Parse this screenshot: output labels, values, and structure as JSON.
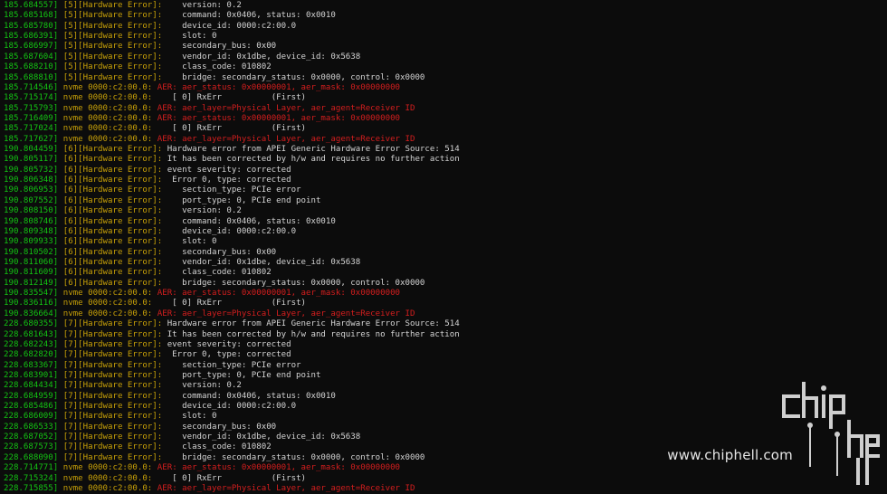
{
  "terminal": {
    "lines": [
      [
        "185.684557]",
        "[5][Hardware Error]:",
        "   version: 0.2",
        "n"
      ],
      [
        "185.685168]",
        "[5][Hardware Error]:",
        "   command: 0x0406, status: 0x0010",
        "n"
      ],
      [
        "185.685780]",
        "[5][Hardware Error]:",
        "   device_id: 0000:c2:00.0",
        "n"
      ],
      [
        "185.686391]",
        "[5][Hardware Error]:",
        "   slot: 0",
        "n"
      ],
      [
        "185.686997]",
        "[5][Hardware Error]:",
        "   secondary_bus: 0x00",
        "n"
      ],
      [
        "185.687604]",
        "[5][Hardware Error]:",
        "   vendor_id: 0x1dbe, device_id: 0x5638",
        "n"
      ],
      [
        "185.688210]",
        "[5][Hardware Error]:",
        "   class_code: 010802",
        "n"
      ],
      [
        "185.688810]",
        "[5][Hardware Error]:",
        "   bridge: secondary_status: 0x0000, control: 0x0000",
        "n"
      ],
      [
        "185.714546]",
        "nvme 0000:c2:00.0:",
        "AER: aer_status: 0x00000001, aer_mask: 0x00000000",
        "e"
      ],
      [
        "185.715174]",
        "nvme 0000:c2:00.0:",
        "   [ 0] RxErr          (First)",
        "n"
      ],
      [
        "185.715793]",
        "nvme 0000:c2:00.0:",
        "AER: aer_layer=Physical Layer, aer_agent=Receiver ID",
        "e"
      ],
      [
        "185.716409]",
        "nvme 0000:c2:00.0:",
        "AER: aer_status: 0x00000001, aer_mask: 0x00000000",
        "e"
      ],
      [
        "185.717024]",
        "nvme 0000:c2:00.0:",
        "   [ 0] RxErr          (First)",
        "n"
      ],
      [
        "185.717627]",
        "nvme 0000:c2:00.0:",
        "AER: aer_layer=Physical Layer, aer_agent=Receiver ID",
        "e"
      ],
      [
        "190.804459]",
        "[6][Hardware Error]:",
        "Hardware error from APEI Generic Hardware Error Source: 514",
        "n"
      ],
      [
        "190.805117]",
        "[6][Hardware Error]:",
        "It has been corrected by h/w and requires no further action",
        "n"
      ],
      [
        "190.805732]",
        "[6][Hardware Error]:",
        "event severity: corrected",
        "n"
      ],
      [
        "190.806348]",
        "[6][Hardware Error]:",
        " Error 0, type: corrected",
        "n"
      ],
      [
        "190.806953]",
        "[6][Hardware Error]:",
        "   section_type: PCIe error",
        "n"
      ],
      [
        "190.807552]",
        "[6][Hardware Error]:",
        "   port_type: 0, PCIe end point",
        "n"
      ],
      [
        "190.808150]",
        "[6][Hardware Error]:",
        "   version: 0.2",
        "n"
      ],
      [
        "190.808746]",
        "[6][Hardware Error]:",
        "   command: 0x0406, status: 0x0010",
        "n"
      ],
      [
        "190.809348]",
        "[6][Hardware Error]:",
        "   device_id: 0000:c2:00.0",
        "n"
      ],
      [
        "190.809933]",
        "[6][Hardware Error]:",
        "   slot: 0",
        "n"
      ],
      [
        "190.810502]",
        "[6][Hardware Error]:",
        "   secondary_bus: 0x00",
        "n"
      ],
      [
        "190.811060]",
        "[6][Hardware Error]:",
        "   vendor_id: 0x1dbe, device_id: 0x5638",
        "n"
      ],
      [
        "190.811609]",
        "[6][Hardware Error]:",
        "   class_code: 010802",
        "n"
      ],
      [
        "190.812149]",
        "[6][Hardware Error]:",
        "   bridge: secondary_status: 0x0000, control: 0x0000",
        "n"
      ],
      [
        "190.835547]",
        "nvme 0000:c2:00.0:",
        "AER: aer_status: 0x00000001, aer_mask: 0x00000000",
        "e"
      ],
      [
        "190.836116]",
        "nvme 0000:c2:00.0:",
        "   [ 0] RxErr          (First)",
        "n"
      ],
      [
        "190.836664]",
        "nvme 0000:c2:00.0:",
        "AER: aer_layer=Physical Layer, aer_agent=Receiver ID",
        "e"
      ],
      [
        "228.680355]",
        "[7][Hardware Error]:",
        "Hardware error from APEI Generic Hardware Error Source: 514",
        "n"
      ],
      [
        "228.681643]",
        "[7][Hardware Error]:",
        "It has been corrected by h/w and requires no further action",
        "n"
      ],
      [
        "228.682243]",
        "[7][Hardware Error]:",
        "event severity: corrected",
        "n"
      ],
      [
        "228.682820]",
        "[7][Hardware Error]:",
        " Error 0, type: corrected",
        "n"
      ],
      [
        "228.683367]",
        "[7][Hardware Error]:",
        "   section_type: PCIe error",
        "n"
      ],
      [
        "228.683901]",
        "[7][Hardware Error]:",
        "   port_type: 0, PCIe end point",
        "n"
      ],
      [
        "228.684434]",
        "[7][Hardware Error]:",
        "   version: 0.2",
        "n"
      ],
      [
        "228.684959]",
        "[7][Hardware Error]:",
        "   command: 0x0406, status: 0x0010",
        "n"
      ],
      [
        "228.685486]",
        "[7][Hardware Error]:",
        "   device_id: 0000:c2:00.0",
        "n"
      ],
      [
        "228.686009]",
        "[7][Hardware Error]:",
        "   slot: 0",
        "n"
      ],
      [
        "228.686533]",
        "[7][Hardware Error]:",
        "   secondary_bus: 0x00",
        "n"
      ],
      [
        "228.687052]",
        "[7][Hardware Error]:",
        "   vendor_id: 0x1dbe, device_id: 0x5638",
        "n"
      ],
      [
        "228.687573]",
        "[7][Hardware Error]:",
        "   class_code: 010802",
        "n"
      ],
      [
        "228.688090]",
        "[7][Hardware Error]:",
        "   bridge: secondary_status: 0x0000, control: 0x0000",
        "n"
      ],
      [
        "228.714771]",
        "nvme 0000:c2:00.0:",
        "AER: aer_status: 0x00000001, aer_mask: 0x00000000",
        "e"
      ],
      [
        "228.715324]",
        "nvme 0000:c2:00.0:",
        "   [ 0] RxErr          (First)",
        "n"
      ],
      [
        "228.715855]",
        "nvme 0000:c2:00.0:",
        "AER: aer_layer=Physical Layer, aer_agent=Receiver ID",
        "e"
      ]
    ]
  },
  "watermark": {
    "text": "www.chiphell.com",
    "logo_text": "chiphell"
  },
  "colors": {
    "background": "#0c0c0c",
    "timestamp": "#13c313",
    "tag": "#c7a008",
    "error": "#d41e1e",
    "text": "#d4d4d4"
  }
}
